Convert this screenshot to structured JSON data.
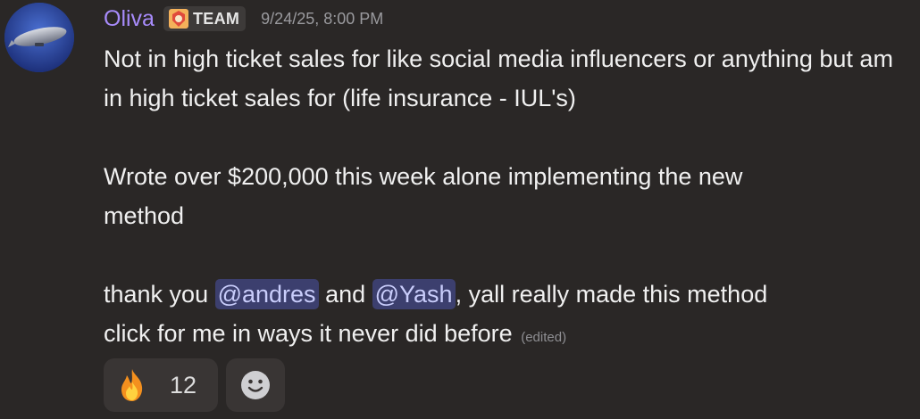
{
  "message": {
    "author": "Oliva",
    "role_tag": "TEAM",
    "timestamp": "9/24/25, 8:00 PM",
    "paragraph1": "Not in high ticket sales for like social media influencers or anything but am in high ticket sales for (life insurance - IUL's)",
    "paragraph2_line1": "Wrote over $200,000 this week alone implementing the new",
    "paragraph2_line2": "method",
    "p3_prefix": "thank you ",
    "mention1": "@andres",
    "p3_mid": " and ",
    "mention2": "@Yash",
    "p3_suffix": ", yall really made this method",
    "p3_line2": "click for me in ways it never did before",
    "edited_label": "(edited)"
  },
  "reactions": [
    {
      "emoji": "fire-icon",
      "count": "12"
    },
    {
      "emoji": "add-reaction-icon"
    }
  ],
  "colors": {
    "background": "#2a2726",
    "username": "#a78bfa",
    "mention_bg": "#3c3f6e",
    "mention_text": "#c9cdfb"
  }
}
